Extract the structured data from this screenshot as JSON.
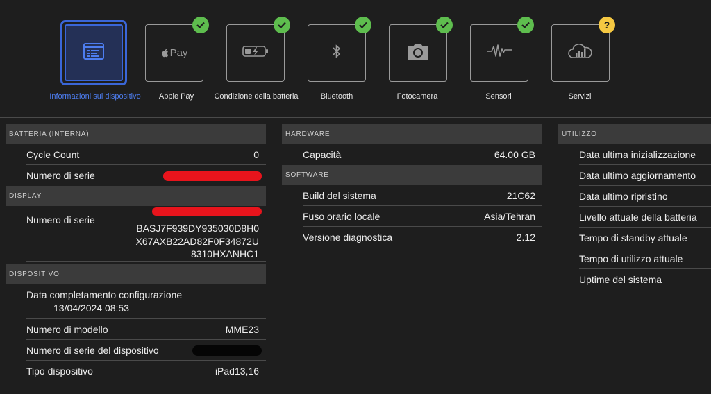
{
  "tiles": [
    {
      "label": "Informazioni sul dispositivo",
      "icon": "device-info-icon",
      "status": "none",
      "active": true
    },
    {
      "label": "Apple Pay",
      "icon": "apple-pay-logo",
      "logo_text": "Pay",
      "status": "ok"
    },
    {
      "label": "Condizione della batteria",
      "icon": "battery-charging-icon",
      "status": "ok"
    },
    {
      "label": "Bluetooth",
      "icon": "bluetooth-icon",
      "status": "ok"
    },
    {
      "label": "Fotocamera",
      "icon": "camera-icon",
      "status": "ok"
    },
    {
      "label": "Sensori",
      "icon": "waveform-icon",
      "status": "ok"
    },
    {
      "label": "Servizi",
      "icon": "cloud-chart-icon",
      "status": "unknown",
      "badge_text": "?"
    }
  ],
  "battery": {
    "title": "BATTERIA (INTERNA)",
    "cycle_count_label": "Cycle Count",
    "cycle_count_value": "0",
    "serial_label": "Numero di serie"
  },
  "display": {
    "title": "DISPLAY",
    "serial_label": "Numero di serie",
    "serial_lines": [
      "BASJ7F939DY935030D8H0",
      "X67AXB22AD82F0F34872U",
      "8310HXANHC1"
    ]
  },
  "device": {
    "title": "DISPOSITIVO",
    "config_label": "Data completamento configurazione",
    "config_value": "13/04/2024 08:53",
    "model_label": "Numero di modello",
    "model_value": "MME23",
    "device_serial_label": "Numero di serie del dispositivo",
    "type_label": "Tipo dispositivo",
    "type_value": "iPad13,16"
  },
  "hardware": {
    "title": "HARDWARE",
    "capacity_label": "Capacità",
    "capacity_value": "64.00 GB"
  },
  "software": {
    "title": "SOFTWARE",
    "rows": [
      {
        "label": "Build del sistema",
        "value": "21C62"
      },
      {
        "label": "Fuso orario locale",
        "value": "Asia/Tehran"
      },
      {
        "label": "Versione diagnostica",
        "value": "2.12"
      }
    ]
  },
  "usage": {
    "title": "UTILIZZO",
    "rows": [
      "Data ultima inizializzazione",
      "Data ultimo aggiornamento",
      "Data ultimo ripristino",
      "Livello attuale della batteria",
      "Tempo di standby attuale",
      "Tempo di utilizzo attuale",
      "Uptime del sistema"
    ]
  },
  "colors": {
    "background": "#1e1e1e",
    "accent": "#3a66d8",
    "ok": "#5ebd4e",
    "warn": "#f5c842",
    "redaction_red": "#e8141c"
  }
}
